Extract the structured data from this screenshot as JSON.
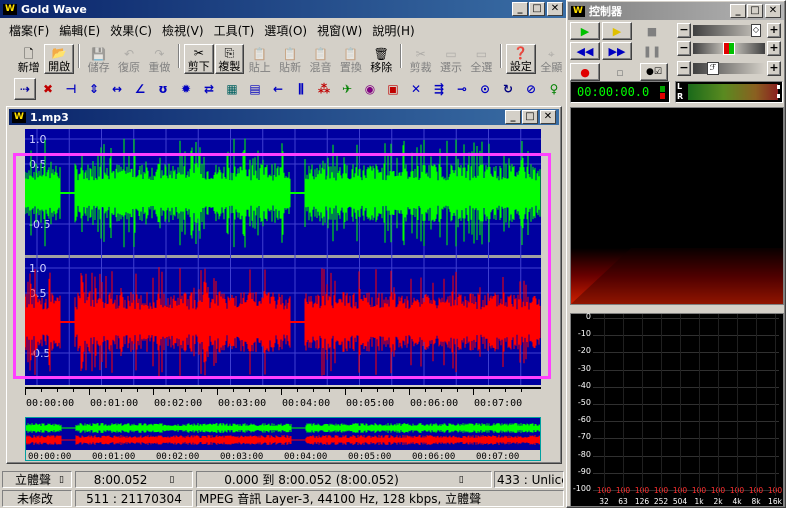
{
  "main_window": {
    "title": "Gold Wave",
    "logo": "W"
  },
  "menu": [
    "檔案(F)",
    "編輯(E)",
    "效果(C)",
    "檢視(V)",
    "工具(T)",
    "選項(O)",
    "視窗(W)",
    "說明(H)"
  ],
  "toolbar": [
    {
      "label": "新增",
      "icon": "new-file-icon",
      "enabled": true
    },
    {
      "label": "開啟",
      "icon": "open-folder-icon",
      "enabled": true
    },
    {
      "label": "儲存",
      "icon": "save-icon",
      "enabled": false
    },
    {
      "label": "復原",
      "icon": "undo-icon",
      "enabled": false
    },
    {
      "label": "重做",
      "icon": "redo-icon",
      "enabled": false
    },
    {
      "label": "剪下",
      "icon": "cut-icon",
      "enabled": true
    },
    {
      "label": "複製",
      "icon": "copy-icon",
      "enabled": true
    },
    {
      "label": "貼上",
      "icon": "paste-icon",
      "enabled": false
    },
    {
      "label": "貼新",
      "icon": "paste-new-icon",
      "enabled": false
    },
    {
      "label": "混音",
      "icon": "mix-icon",
      "enabled": false
    },
    {
      "label": "置換",
      "icon": "replace-icon",
      "enabled": false
    },
    {
      "label": "移除",
      "icon": "delete-icon",
      "enabled": true
    },
    {
      "label": "剪裁",
      "icon": "trim-icon",
      "enabled": false
    },
    {
      "label": "選示",
      "icon": "select-view-icon",
      "enabled": false
    },
    {
      "label": "全選",
      "icon": "select-all-icon",
      "enabled": false
    },
    {
      "label": "設定",
      "icon": "settings-icon",
      "enabled": true
    },
    {
      "label": "全顯",
      "icon": "show-all-icon",
      "enabled": false
    }
  ],
  "effects_toolbar": [
    "⇢",
    "✖",
    "⊣",
    "⇕",
    "↔",
    "∠",
    "ʊ",
    "✹",
    "⇄",
    "▦",
    "▤",
    "←",
    "⫼",
    "⁂",
    "✈",
    "◉",
    "▣",
    "✕",
    "⇶",
    "⊸",
    "⊙",
    "↻",
    "⊘",
    "♀"
  ],
  "wave_window": {
    "title": "1.mp3",
    "y_labels": [
      "1.0",
      "0.5",
      "0.0",
      "-0.5"
    ],
    "time_labels": [
      "00:00:00",
      "00:01:00",
      "00:02:00",
      "00:03:00",
      "00:04:00",
      "00:05:00",
      "00:06:00",
      "00:07:00"
    ],
    "overview_labels": [
      "00:00:00",
      "00:01:00",
      "00:02:00",
      "00:03:00",
      "00:04:00",
      "00:05:00",
      "00:06:00",
      "00:07:00"
    ],
    "colors": {
      "background": "#0000a0",
      "left_channel": "#00ff00",
      "right_channel": "#ff0000",
      "selection": "#ff40ff",
      "grid": "#3f3fd0"
    }
  },
  "status": {
    "channels": "立體聲",
    "length": "8:00.052",
    "selection": "0.000 到 8:00.052 (8:00.052)",
    "zoom": "433 : Unlicen",
    "modified": "未修改",
    "position": "511 : 21170304",
    "format": "MPEG 音訊  Layer-3, 44100 Hz, 128 kbps, 立體聲"
  },
  "control_window": {
    "title": "控制器",
    "logo": "W",
    "time": "00:00:00.0",
    "meter_lr": "L\nR",
    "spectrum_y": [
      "0",
      "-10",
      "-20",
      "-30",
      "-40",
      "-50",
      "-60",
      "-70",
      "-80",
      "-90",
      "-100"
    ],
    "spectrum_x": [
      "32",
      "63",
      "126",
      "252",
      "504",
      "1k",
      "2k",
      "4k",
      "8k",
      "16k"
    ],
    "spectrum_vals": [
      "100",
      "100",
      "100",
      "100",
      "100",
      "100",
      "100",
      "100",
      "100",
      "100"
    ]
  }
}
